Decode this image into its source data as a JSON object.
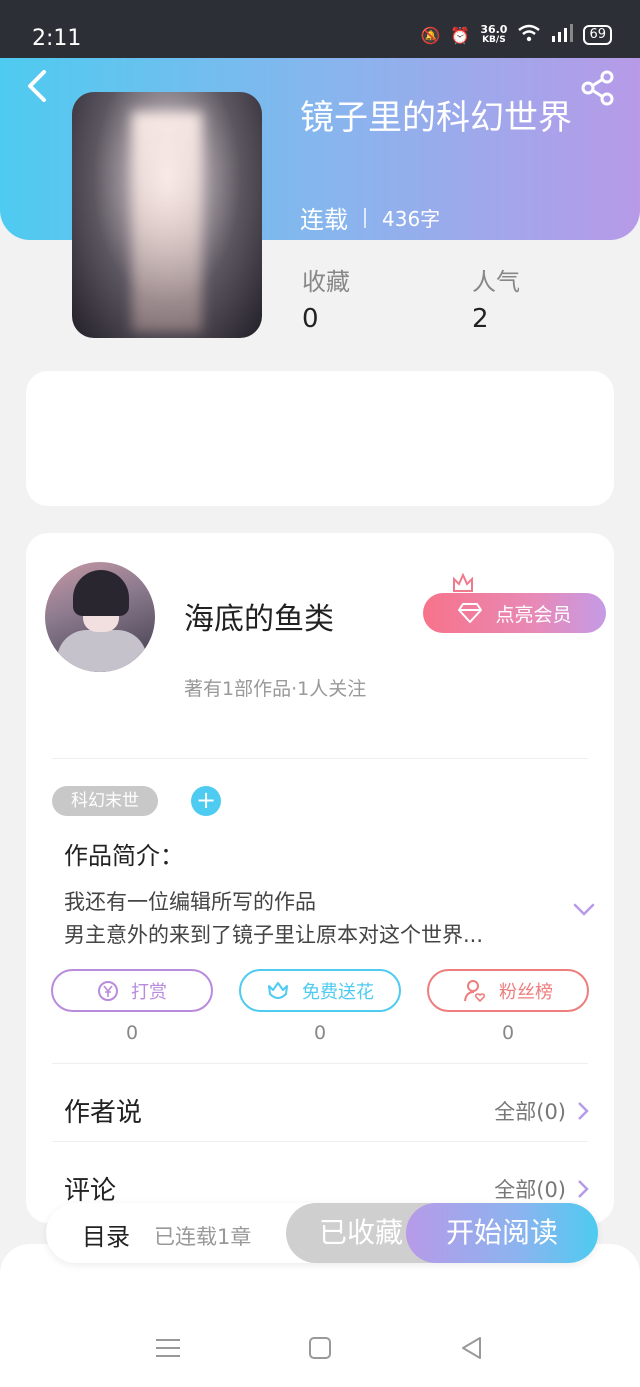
{
  "status": {
    "time": "2:11",
    "net_speed": "36.0",
    "net_unit": "KB/S",
    "battery": "69"
  },
  "book": {
    "title": "镜子里的科幻世界",
    "status": "连载",
    "word_count": "436字",
    "favorites_label": "收藏",
    "favorites_value": "0",
    "popularity_label": "人气",
    "popularity_value": "2"
  },
  "author": {
    "name": "海底的鱼类",
    "summary": "著有1部作品·1人关注",
    "vip_label": "点亮会员"
  },
  "tags": [
    {
      "label": "科幻末世"
    }
  ],
  "intro": {
    "label": "作品简介：",
    "lines": [
      "我还有一位编辑所写的作品",
      "男主意外的来到了镜子里让原本对这个世界..."
    ]
  },
  "actions": [
    {
      "label": "打赏",
      "count": "0"
    },
    {
      "label": "免费送花",
      "count": "0"
    },
    {
      "label": "粉丝榜",
      "count": "0"
    }
  ],
  "sections": [
    {
      "label": "作者说",
      "right": "全部(0)"
    },
    {
      "label": "评论",
      "right": "全部(0)"
    }
  ],
  "bottom_bar": {
    "toc_label": "目录",
    "chapters": "已连载1章",
    "collected_label": "已收藏",
    "read_label": "开始阅读"
  },
  "colors": {
    "accent_cyan": "#4ecbf0",
    "accent_purple": "#b79ae8",
    "reward": "#b98bdc",
    "flower": "#4ecbf0",
    "fans": "#ee7d7d"
  }
}
